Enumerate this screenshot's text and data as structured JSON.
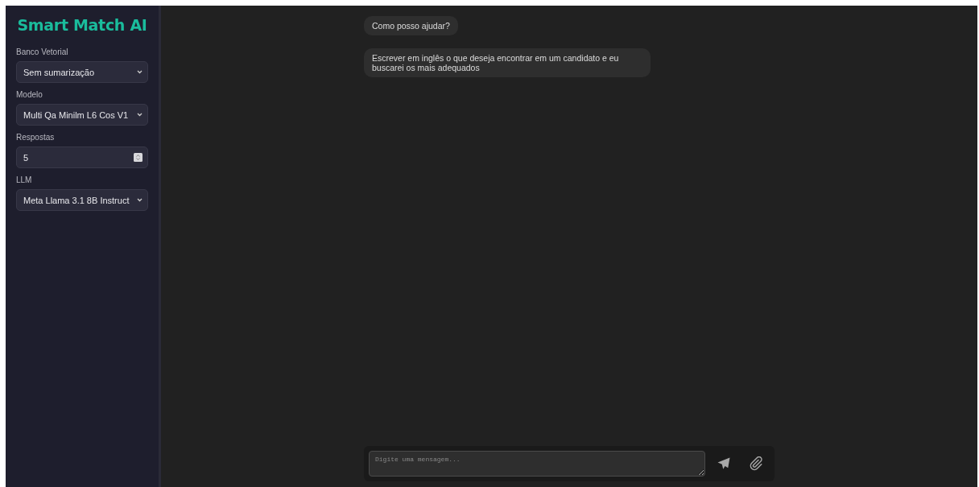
{
  "sidebar": {
    "title": "Smart Match AI",
    "fields": [
      {
        "label": "Banco Vetorial",
        "kind": "select",
        "value": "Sem sumarização"
      },
      {
        "label": "Modelo",
        "kind": "select",
        "value": "Multi Qa Minilm L6 Cos V1"
      },
      {
        "label": "Respostas",
        "kind": "number",
        "value": "5"
      },
      {
        "label": "LLM",
        "kind": "select",
        "value": "Meta Llama 3.1 8B Instruct"
      }
    ]
  },
  "messages": [
    {
      "text": "Como posso ajudar?"
    },
    {
      "text": "Escrever em inglês o que deseja encontrar em um candidato e eu buscarei os mais adequados"
    }
  ],
  "composer": {
    "placeholder": "Digite uma mensagem..."
  }
}
